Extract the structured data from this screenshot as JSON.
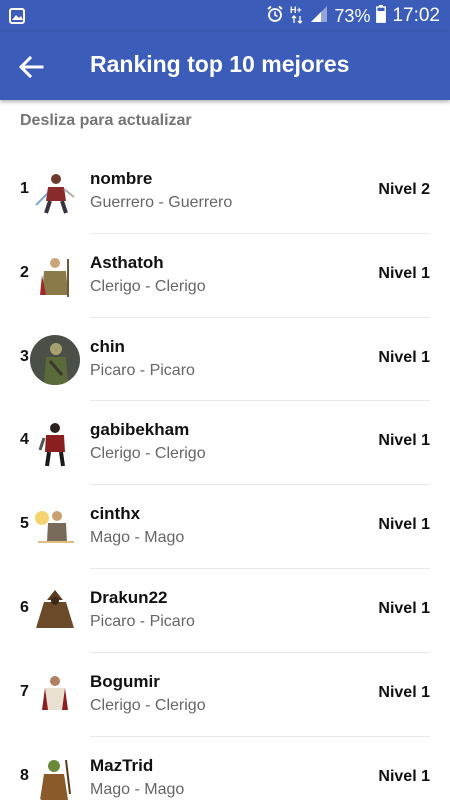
{
  "status_bar": {
    "battery": "73%",
    "time": "17:02",
    "icons": [
      "gallery-icon",
      "alarm-icon",
      "hplus-signal-icon",
      "signal-bars-icon",
      "battery-icon"
    ]
  },
  "toolbar": {
    "back_icon": "arrow-left-icon",
    "title": "Ranking top 10 mejores"
  },
  "hint": "Desliza para actualizar",
  "ranking": [
    {
      "rank": "1",
      "name": "nombre",
      "class": "Guerrero - Guerrero",
      "level": "Nivel 2"
    },
    {
      "rank": "2",
      "name": "Asthatoh",
      "class": "Clerigo - Clerigo",
      "level": "Nivel 1"
    },
    {
      "rank": "3",
      "name": "chin",
      "class": "Picaro - Picaro",
      "level": "Nivel 1"
    },
    {
      "rank": "4",
      "name": "gabibekham",
      "class": "Clerigo - Clerigo",
      "level": "Nivel 1"
    },
    {
      "rank": "5",
      "name": "cinthx",
      "class": "Mago - Mago",
      "level": "Nivel 1"
    },
    {
      "rank": "6",
      "name": "Drakun22",
      "class": "Picaro - Picaro",
      "level": "Nivel 1"
    },
    {
      "rank": "7",
      "name": "Bogumir",
      "class": "Clerigo - Clerigo",
      "level": "Nivel 1"
    },
    {
      "rank": "8",
      "name": "MazTrid",
      "class": "Mago - Mago",
      "level": "Nivel 1"
    }
  ],
  "colors": {
    "primary": "#3b5cb8",
    "text": "#111111",
    "secondary_text": "#666666",
    "hint_text": "#757575"
  }
}
